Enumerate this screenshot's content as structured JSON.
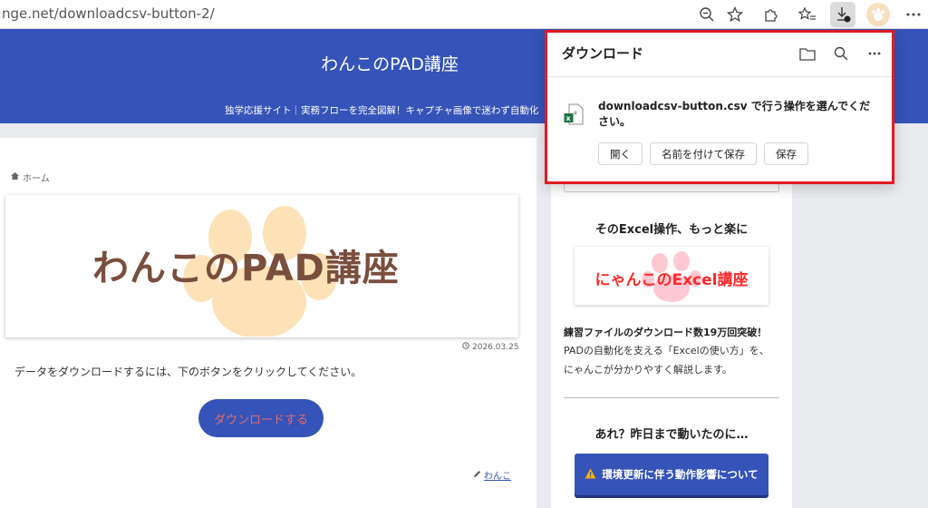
{
  "browser": {
    "url": "nge.net/downloadcsv-button-2/",
    "icons": [
      "zoom-out-icon",
      "star-icon",
      "extensions-icon",
      "favorites-icon",
      "downloads-icon",
      "profile-avatar"
    ]
  },
  "site": {
    "title": "わんこのPAD講座",
    "tagline": "独学応援サイト｜実務フローを完全図解！キャプチャ画像で迷わず自動化"
  },
  "main": {
    "breadcrumb_home": "ホーム",
    "hero_text": "わんこのPAD講座",
    "date": "2026.03.25",
    "body_text": "データをダウンロードするには、下のボタンをクリックしてください。",
    "download_button": "ダウンロードする",
    "author": "わんこ"
  },
  "sidebar": {
    "heading1": "そのExcel操作、もっと楽に",
    "banner_text": "にゃんこのExcel講座",
    "bold_text": "練習ファイルのダウンロード数19万回突破！",
    "text_line1": "PADの自動化を支える「Excelの使い方」を、",
    "text_line2": "にゃんこが分かりやすく解説します。",
    "heading2": "あれ？昨日まで動いたのに…",
    "button_label": "環境更新に伴う動作影響について"
  },
  "download_panel": {
    "title": "ダウンロード",
    "message": "downloadcsv-button.csv で行う操作を選んでください。",
    "buttons": [
      "開く",
      "名前を付けて保存",
      "保存"
    ]
  },
  "colors": {
    "header_blue": "#3553b8",
    "highlight_red": "#e01b24",
    "hero_brown": "#7a4e3d",
    "paw_cream": "#fde2b8"
  }
}
